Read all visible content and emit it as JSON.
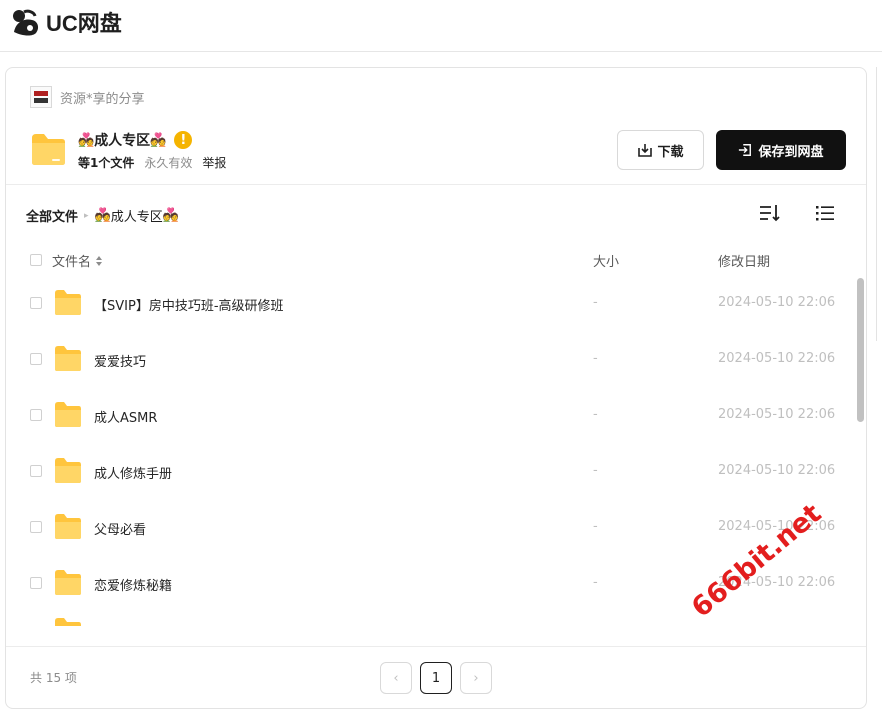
{
  "app": {
    "name": "UC网盘"
  },
  "share": {
    "sharer_name": "资源*享的分享",
    "title": "成人专区",
    "emoji": "💑",
    "warning_symbol": "!",
    "meta": {
      "count": "等1个文件",
      "validity": "永久有效",
      "report": "举报"
    },
    "download_label": "下载",
    "save_label": "保存到网盘"
  },
  "breadcrumb": {
    "root": "全部文件",
    "current": "成人专区",
    "separator": "▸"
  },
  "table": {
    "headers": {
      "name": "文件名",
      "size": "大小",
      "date": "修改日期"
    },
    "rows": [
      {
        "name": "【SVIP】房中技巧班-高级研修班",
        "size": "-",
        "date": "2024-05-10 22:06"
      },
      {
        "name": "爱爱技巧",
        "size": "-",
        "date": "2024-05-10 22:06"
      },
      {
        "name": "成人ASMR",
        "size": "-",
        "date": "2024-05-10 22:06"
      },
      {
        "name": "成人修炼手册",
        "size": "-",
        "date": "2024-05-10 22:06"
      },
      {
        "name": "父母必看",
        "size": "-",
        "date": "2024-05-10 22:06"
      },
      {
        "name": "恋爱修炼秘籍",
        "size": "-",
        "date": "2024-05-10 22:06"
      }
    ]
  },
  "footer": {
    "total": "共 15 项",
    "current_page": "1",
    "prev_symbol": "‹",
    "next_symbol": "›"
  },
  "watermark": "666bit.net",
  "colors": {
    "folder": "#ffc53d",
    "primary_button": "#111111",
    "watermark": "#e31e1e"
  },
  "icons": [
    "uc-logo-icon",
    "folder-icon",
    "warning-icon",
    "download-icon",
    "save-icon",
    "sort-icon",
    "list-view-icon",
    "sort-arrows-icon"
  ]
}
